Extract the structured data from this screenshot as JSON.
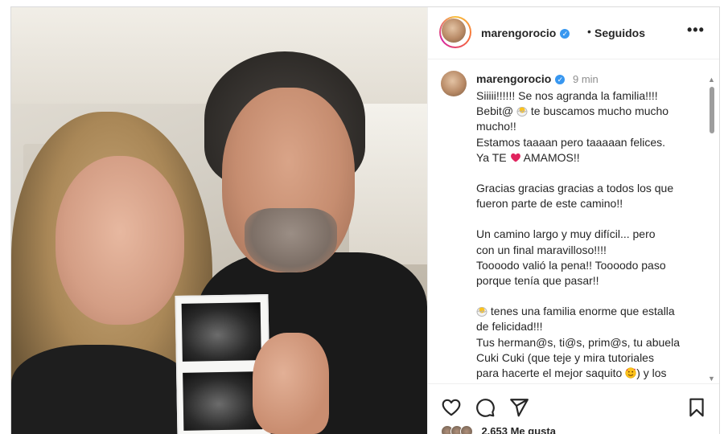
{
  "post": {
    "username": "marengorocio",
    "follow_status": "Seguidos",
    "separator": "•",
    "more_icon": "more-icon",
    "verified_icon": "verified-icon"
  },
  "caption": {
    "username": "marengorocio",
    "time": "9 min",
    "lines": [
      "Siiiii!!!!!! Se nos agranda la familia!!!!",
      "Bebit@",
      " te buscamos mucho mucho",
      "mucho!!",
      "Estamos taaaan pero taaaaan felices.",
      "Ya TE",
      " AMAMOS!!",
      "Gracias gracias gracias a todos los que",
      "fueron parte de este camino!!",
      "Un camino largo y muy difícil... pero",
      "con un final maravilloso!!!!",
      "Toooodo valió la pena!! Toooodo paso",
      "porque tenía que pasar!!",
      " tenes una familia enorme que estalla",
      "de felicidad!!!",
      "Tus herman@s, ti@s, prim@s, tu abuela",
      "Cuki Cuki (que teje y mira tutoriales",
      "para hacerte el mejor saquito",
      ") y los"
    ]
  },
  "actions": {
    "like_icon": "heart-icon",
    "comment_icon": "comment-icon",
    "share_icon": "share-icon",
    "save_icon": "bookmark-icon"
  },
  "likes": {
    "partial_text": "2.653 Me gusta"
  },
  "colors": {
    "text": "#262626",
    "muted": "#8e8e8e",
    "verified": "#3897f0",
    "heart": "#e0245e"
  }
}
